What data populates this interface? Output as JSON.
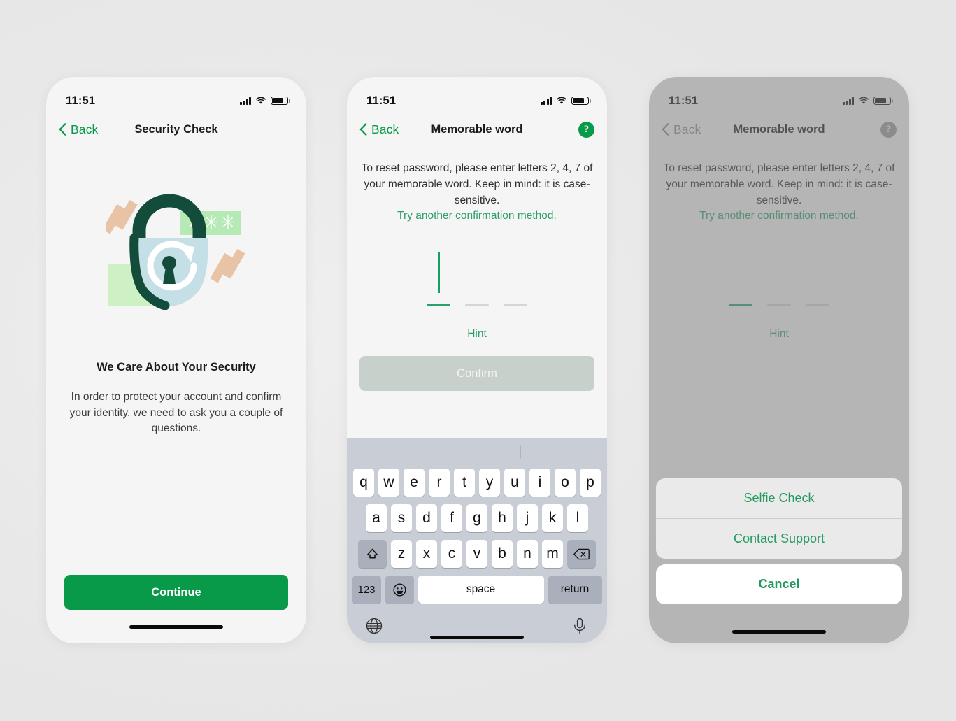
{
  "theme": {
    "brand_green": "#089949",
    "link_green": "#2ca06a",
    "sheet_green": "#229a5e",
    "disabled_grey": "#c8d0cb",
    "screen_bg": "#f5f5f5",
    "keyboard_bg": "#c9ced6"
  },
  "status_bar": {
    "time": "11:51"
  },
  "screen1": {
    "nav": {
      "back_label": "Back",
      "title": "Security Check"
    },
    "illustration": {
      "name": "padlock-refresh-illustration",
      "asterisks": "✳ ✳ ✳",
      "colors": {
        "shackle": "#134c3b",
        "body": "#c5dfe6",
        "badge": "#b6eab4",
        "square": "#cdf0c4",
        "stripe": "#e8c3a6"
      }
    },
    "heading": "We Care About Your Security",
    "body_text": "In order to protect your account and confirm your identity, we need to ask you a couple of questions.",
    "primary_button": "Continue"
  },
  "screen2": {
    "nav": {
      "back_label": "Back",
      "title": "Memorable word",
      "help_glyph": "?"
    },
    "instruction": "To reset password, please enter letters 2, 4, 7 of your memorable word. Keep in mind: it is case-sensitive.",
    "link": "Try another confirmation method.",
    "code_input": {
      "value": "",
      "slots": 3,
      "active_slot": 1,
      "caret_visible": true
    },
    "hint_label": "Hint",
    "confirm_button": {
      "label": "Confirm",
      "disabled": true
    },
    "keyboard": {
      "row1": [
        "q",
        "w",
        "e",
        "r",
        "t",
        "y",
        "u",
        "i",
        "o",
        "p"
      ],
      "row2": [
        "a",
        "s",
        "d",
        "f",
        "g",
        "h",
        "j",
        "k",
        "l"
      ],
      "row3": [
        "z",
        "x",
        "c",
        "v",
        "b",
        "n",
        "m"
      ],
      "shift_icon": "shift-icon",
      "backspace_icon": "backspace-icon",
      "numeric_label": "123",
      "emoji_icon": "emoji-icon",
      "space_label": "space",
      "return_label": "return",
      "globe_icon": "globe-icon",
      "mic_icon": "microphone-icon"
    }
  },
  "screen3": {
    "nav": {
      "back_label": "Back",
      "title": "Memorable word",
      "help_glyph": "?"
    },
    "instruction": "To reset password, please enter letters 2, 4, 7 of your memorable word. Keep in mind: it is case-sensitive.",
    "link": "Try another confirmation method.",
    "code_input": {
      "slots": 3,
      "active_slot": 1,
      "caret_visible": false
    },
    "hint_label": "Hint",
    "action_sheet": {
      "options": [
        "Selfie Check",
        "Contact Support"
      ],
      "cancel_label": "Cancel"
    }
  }
}
